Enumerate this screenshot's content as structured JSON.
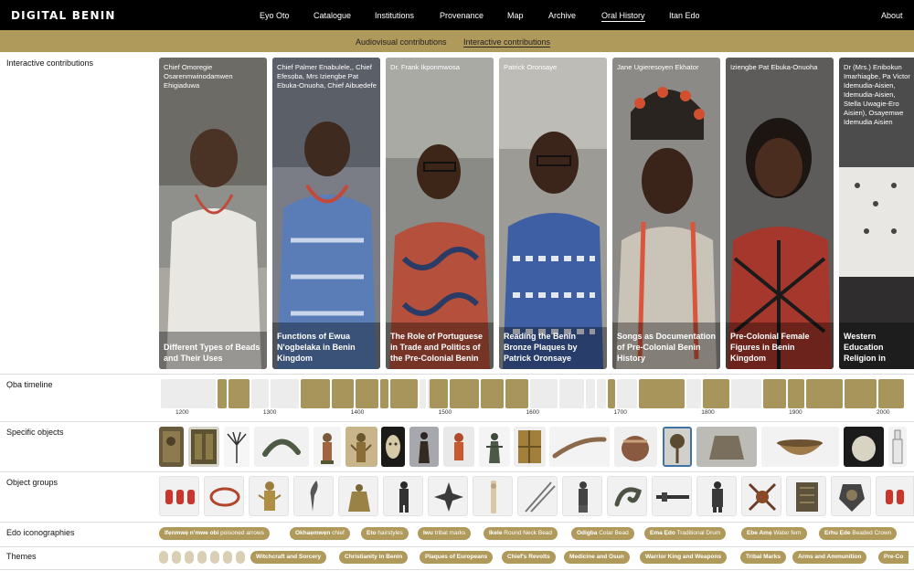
{
  "nav": {
    "logo": "DIGITAL BENIN",
    "items": [
      "Ẹyo Otọ",
      "Catalogue",
      "Institutions",
      "Provenance",
      "Map",
      "Archive",
      "Oral History",
      "Itan Edo"
    ],
    "active": "Oral History",
    "about": "About"
  },
  "subnav": {
    "items": [
      "Audiovisual contributions",
      "Interactive contributions"
    ],
    "active": "Interactive contributions"
  },
  "sections": {
    "contributions": "Interactive contributions",
    "timeline": "Ọba timeline",
    "specific": "Specific objects",
    "groups": "Object groups",
    "iconographies": "Edo iconographies",
    "themes": "Themes"
  },
  "cards": [
    {
      "name": "Chief Omoregie Osarenmwinodamwen Ehigiaduwa",
      "title": "Different Types of Beads and Their Uses"
    },
    {
      "name": "Chief Palmer Enabulele,, Chief Efesọba, Mrs Iziengbe Pat Ebuka-Onuoha, Chief Aibuẹdefe",
      "title": "Functions of Ewua N'ogbelaka in Benin Kingdom"
    },
    {
      "name": "Dr. Frank Ikponmwosa",
      "title": "The Role of Portuguese in Trade and Politics of the Pre-Colonial Benin"
    },
    {
      "name": "Patrick Oronsaye",
      "title": "Reading the Benin Bronze Plaques by Patrick Oronsaye"
    },
    {
      "name": "Jane Ugieresoyen Ekhator",
      "title": "Songs as Documentation of Pre-Colonial Benin History"
    },
    {
      "name": "Iziengbe Pat Ebuka-Onuoha",
      "title": "Pre-Colonial Female Figures in Benin Kingdom"
    },
    {
      "name": "Dr (Mrs.) Enibokun Imarhiagbe, Pa Victor Idemudia-Aisien, Idemudia-Aisien, Stella Uwagie-Ero Aisien), Osayemwe Idemudia Aisien",
      "title": "Western Education Religion in Colonial Benin"
    }
  ],
  "timeline": {
    "range": [
      1175,
      2025
    ],
    "ticks": [
      "1200",
      "1300",
      "1400",
      "1500",
      "1600",
      "1700",
      "1800",
      "1900",
      "2000"
    ],
    "tick_values": [
      1200,
      1300,
      1400,
      1500,
      1600,
      1700,
      1800,
      1900,
      2000
    ],
    "reigns": [
      [
        1175,
        1240,
        0
      ],
      [
        1240,
        1252,
        1
      ],
      [
        1252,
        1278,
        1
      ],
      [
        1278,
        1300,
        0
      ],
      [
        1300,
        1335,
        0
      ],
      [
        1335,
        1370,
        1
      ],
      [
        1370,
        1397,
        1
      ],
      [
        1397,
        1425,
        1
      ],
      [
        1425,
        1437,
        1
      ],
      [
        1437,
        1470,
        1
      ],
      [
        1470,
        1480,
        0
      ],
      [
        1480,
        1482,
        0
      ],
      [
        1482,
        1505,
        1
      ],
      [
        1505,
        1540,
        1
      ],
      [
        1540,
        1568,
        1
      ],
      [
        1568,
        1596,
        1
      ],
      [
        1596,
        1630,
        0
      ],
      [
        1630,
        1660,
        0
      ],
      [
        1660,
        1672,
        0
      ],
      [
        1672,
        1685,
        0
      ],
      [
        1685,
        1695,
        1
      ],
      [
        1695,
        1720,
        0
      ],
      [
        1720,
        1775,
        1
      ],
      [
        1775,
        1793,
        0
      ],
      [
        1793,
        1826,
        1
      ],
      [
        1826,
        1862,
        0
      ],
      [
        1862,
        1890,
        1
      ],
      [
        1890,
        1911,
        1
      ],
      [
        1911,
        1955,
        1
      ],
      [
        1955,
        1994,
        1
      ],
      [
        1994,
        2025,
        1
      ]
    ],
    "colors": {
      "active": "#a8955b",
      "inactive": "#ececec"
    }
  },
  "specific_objects": [
    "plaque",
    "plaque-dark",
    "whisk",
    "bracelet",
    "figure-red",
    "figure-standing",
    "mask-pendant",
    "figure-dark",
    "figure-small",
    "figure-standing-2",
    "plaque-gold",
    "staff",
    "head-ornament",
    "mirror",
    "textile",
    "bowl",
    "jar",
    "bottle"
  ],
  "object_groups": [
    "coral-beads",
    "necklace",
    "figure-gold",
    "blade",
    "altar",
    "figure-dark",
    "cross",
    "tusk",
    "spears",
    "standing-figure",
    "manilla",
    "rod",
    "warrior",
    "crossed-weapons",
    "box",
    "ornate-mask",
    "beads-2"
  ],
  "iconographies": [
    {
      "edo": "Ifẹnmwẹ n'mwe obi",
      "en": "poisoned arrows"
    },
    {
      "edo": "Okhaẹmwẹn",
      "en": "chief"
    },
    {
      "edo": "Eto",
      "en": "hairstyles"
    },
    {
      "edo": "Iwu",
      "en": "tribal marks"
    },
    {
      "edo": "Ikele",
      "en": "Round Neck Bead"
    },
    {
      "edo": "Odigba",
      "en": "Colar Bead"
    },
    {
      "edo": "Ema Ẹdo",
      "en": "Traditional Drum"
    },
    {
      "edo": "Ebe Amẹ",
      "en": "Water fern"
    },
    {
      "edo": "Erhu Ẹde",
      "en": "Beaded Crown"
    }
  ],
  "themes": [
    "Witchcraft and Sorcery",
    "Christianity in Benin",
    "Plaques of Europeans",
    "Chief's Revolts",
    "Medicine and Osun",
    "Warrior King and Weapons",
    "Tribal Marks",
    "Arms and Ammunition",
    "Pre-Co"
  ],
  "colors": {
    "accent": "#b09a5b",
    "nav_bg": "#000000"
  }
}
